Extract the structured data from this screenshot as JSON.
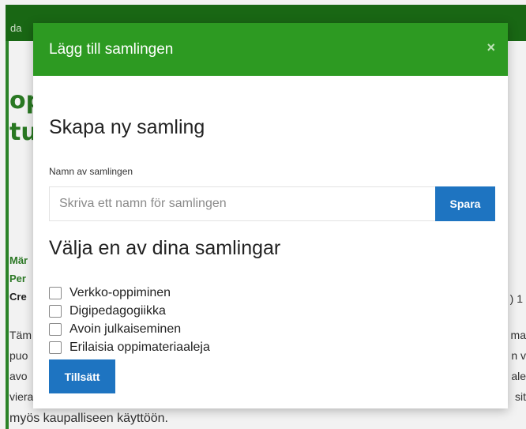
{
  "background": {
    "header_brand": "da",
    "title_line_1": "op",
    "title_line_2": "tu",
    "meta_1": "Mär",
    "meta_2": "Per",
    "meta_3": "Cre",
    "meta_right": ") 1",
    "body_left": [
      "Täm",
      "puo",
      "avo",
      "viera"
    ],
    "body_right": [
      "ma",
      "n v",
      "ale",
      "sit"
    ],
    "body_last_line": "myös kaupalliseen käyttöön."
  },
  "modal": {
    "title": "Lägg till samlingen",
    "close_symbol": "×",
    "create_heading": "Skapa ny samling",
    "name_label": "Namn av samlingen",
    "name_placeholder": "Skriva ett namn för samlingen",
    "name_value": "",
    "save_label": "Spara",
    "choose_heading": "Välja en av dina samlingar",
    "collections": [
      {
        "label": "Verkko-oppiminen",
        "checked": false
      },
      {
        "label": "Digipedagogiikka",
        "checked": false
      },
      {
        "label": "Avoin julkaiseminen",
        "checked": false
      },
      {
        "label": "Erilaisia oppimateriaaleja",
        "checked": false
      }
    ],
    "add_label": "Tillsätt"
  },
  "colors": {
    "header_green": "#2d9a22",
    "page_header_green": "#1b6d16",
    "button_blue": "#1e74c1"
  }
}
